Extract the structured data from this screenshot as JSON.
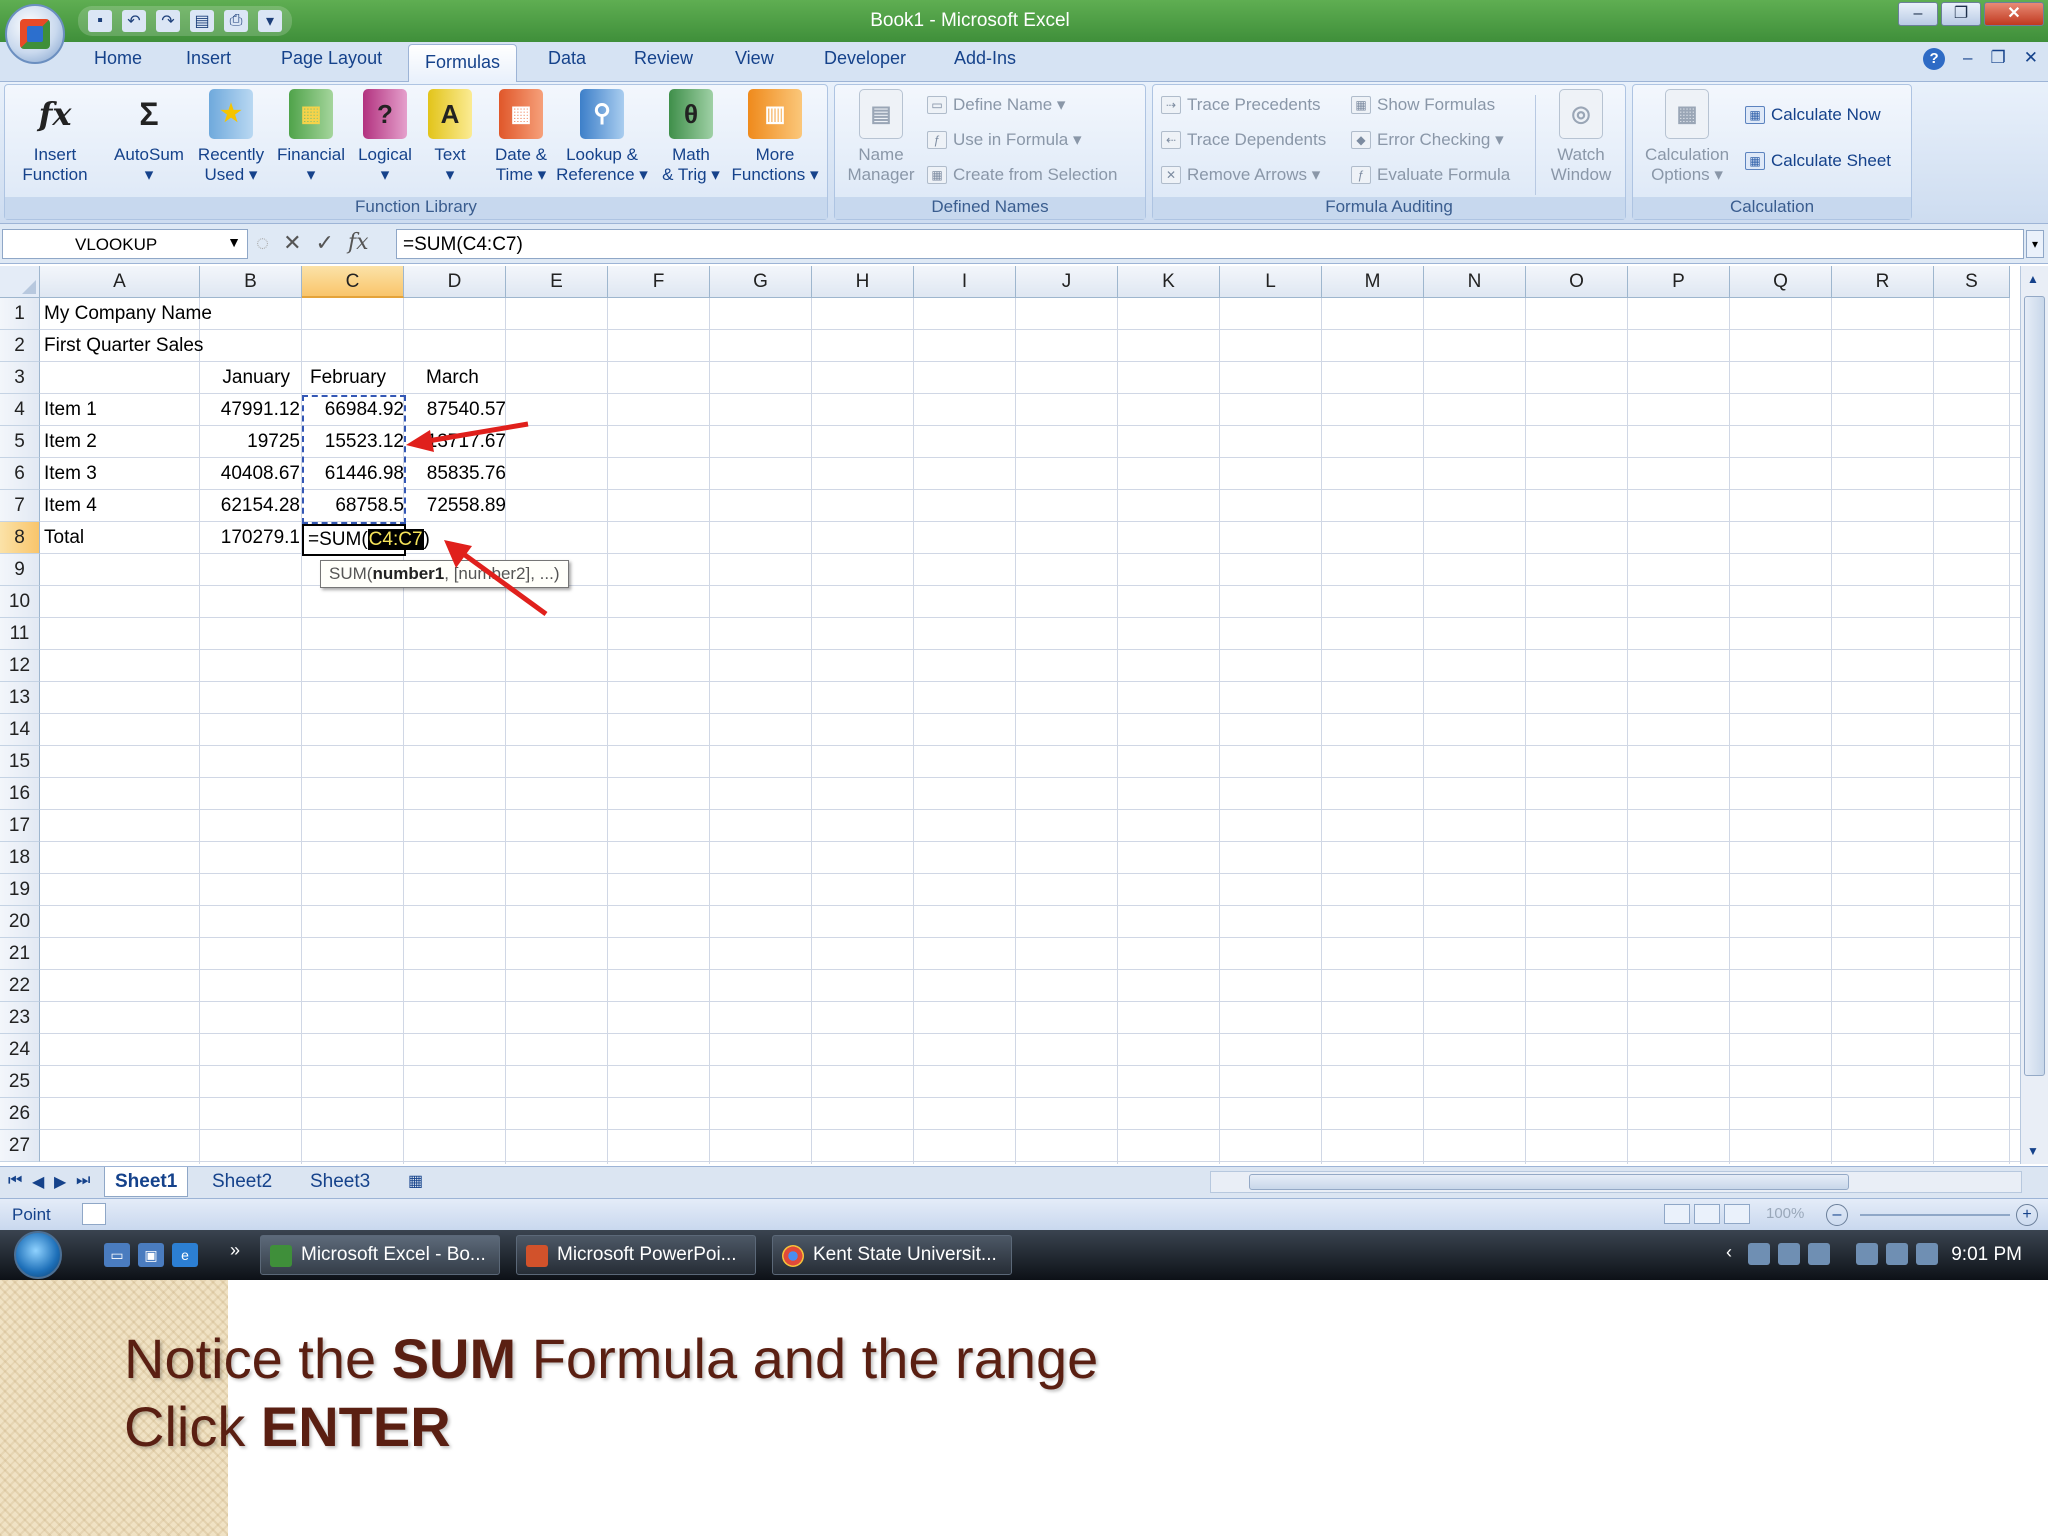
{
  "window": {
    "title": "Book1 - Microsoft Excel"
  },
  "tabs": [
    "Home",
    "Insert",
    "Page Layout",
    "Formulas",
    "Data",
    "Review",
    "View",
    "Developer",
    "Add-Ins"
  ],
  "active_tab": "Formulas",
  "ribbon": {
    "function_library": {
      "label": "Function Library",
      "buttons": [
        {
          "l1": "Insert",
          "l2": "Function",
          "icon": "fx-icon"
        },
        {
          "l1": "AutoSum",
          "l2": "▾",
          "icon": "sigma-icon"
        },
        {
          "l1": "Recently",
          "l2": "Used ▾",
          "icon": "book-star-icon"
        },
        {
          "l1": "Financial",
          "l2": "▾",
          "icon": "book-financial-icon"
        },
        {
          "l1": "Logical",
          "l2": "▾",
          "icon": "book-question-icon"
        },
        {
          "l1": "Text",
          "l2": "▾",
          "icon": "book-text-icon"
        },
        {
          "l1": "Date &",
          "l2": "Time ▾",
          "icon": "book-calendar-icon"
        },
        {
          "l1": "Lookup &",
          "l2": "Reference ▾",
          "icon": "book-lookup-icon"
        },
        {
          "l1": "Math",
          "l2": "& Trig ▾",
          "icon": "book-theta-icon"
        },
        {
          "l1": "More",
          "l2": "Functions ▾",
          "icon": "books-more-icon"
        }
      ]
    },
    "defined_names": {
      "label": "Defined Names",
      "name_manager": {
        "l1": "Name",
        "l2": "Manager"
      },
      "define_name": "Define Name ▾",
      "use_in_formula": "Use in Formula ▾",
      "create_from_selection": "Create from Selection"
    },
    "formula_auditing": {
      "label": "Formula Auditing",
      "trace_precedents": "Trace Precedents",
      "trace_dependents": "Trace Dependents",
      "remove_arrows": "Remove Arrows ▾",
      "show_formulas": "Show Formulas",
      "error_checking": "Error Checking ▾",
      "evaluate_formula": "Evaluate Formula",
      "watch_window": {
        "l1": "Watch",
        "l2": "Window"
      }
    },
    "calculation": {
      "label": "Calculation",
      "options": {
        "l1": "Calculation",
        "l2": "Options ▾"
      },
      "calculate_now": "Calculate Now",
      "calculate_sheet": "Calculate Sheet"
    }
  },
  "formula_bar": {
    "name_box": "VLOOKUP",
    "formula": "=SUM(C4:C7)"
  },
  "columns": [
    "A",
    "B",
    "C",
    "D",
    "E",
    "F",
    "G",
    "H",
    "I",
    "J",
    "K",
    "L",
    "M",
    "N",
    "O",
    "P",
    "Q",
    "R",
    "S"
  ],
  "rows": [
    "1",
    "2",
    "3",
    "4",
    "5",
    "6",
    "7",
    "8",
    "9",
    "10",
    "11",
    "12",
    "13",
    "14",
    "15",
    "16",
    "17",
    "18",
    "19",
    "20",
    "21",
    "22",
    "23",
    "24",
    "25",
    "26",
    "27"
  ],
  "sheet": {
    "a1": "My Company Name",
    "a2": "First Quarter Sales",
    "headers": [
      "January",
      "February",
      "March"
    ],
    "items": [
      {
        "name": "Item 1",
        "jan": "47991.12",
        "feb": "66984.92",
        "mar": "87540.57"
      },
      {
        "name": "Item 2",
        "jan": "19725",
        "feb": "15523.12",
        "mar": "13717.67"
      },
      {
        "name": "Item 3",
        "jan": "40408.67",
        "feb": "61446.98",
        "mar": "85835.76"
      },
      {
        "name": "Item 4",
        "jan": "62154.28",
        "feb": "68758.5",
        "mar": "72558.89"
      }
    ],
    "total_label": "Total",
    "total_jan": "170279.1",
    "edit_prefix": "=SUM(",
    "edit_range": "C4:C7",
    "edit_suffix": ")"
  },
  "tooltip": {
    "pre": "SUM(",
    "bold": "number1",
    "post": ", [number2], ...)"
  },
  "sheet_tabs": [
    "Sheet1",
    "Sheet2",
    "Sheet3"
  ],
  "status": {
    "mode": "Point",
    "zoom": "100%"
  },
  "taskbar": {
    "tasks": [
      "Microsoft Excel - Bo...",
      "Microsoft PowerPoi...",
      "Kent State Universit..."
    ],
    "clock": "9:01 PM"
  },
  "caption": {
    "line1_pre": "Notice the ",
    "line1_bold": "SUM",
    "line1_post": " Formula and the range",
    "line2_pre": "Click ",
    "line2_bold": "ENTER"
  },
  "colors": {
    "title_green": "#4a9b45",
    "ribbon_blue": "#15428b",
    "arrow_red": "#e0201c",
    "caption_brown": "#5a1f12",
    "range_highlight": "#f6e35a"
  }
}
